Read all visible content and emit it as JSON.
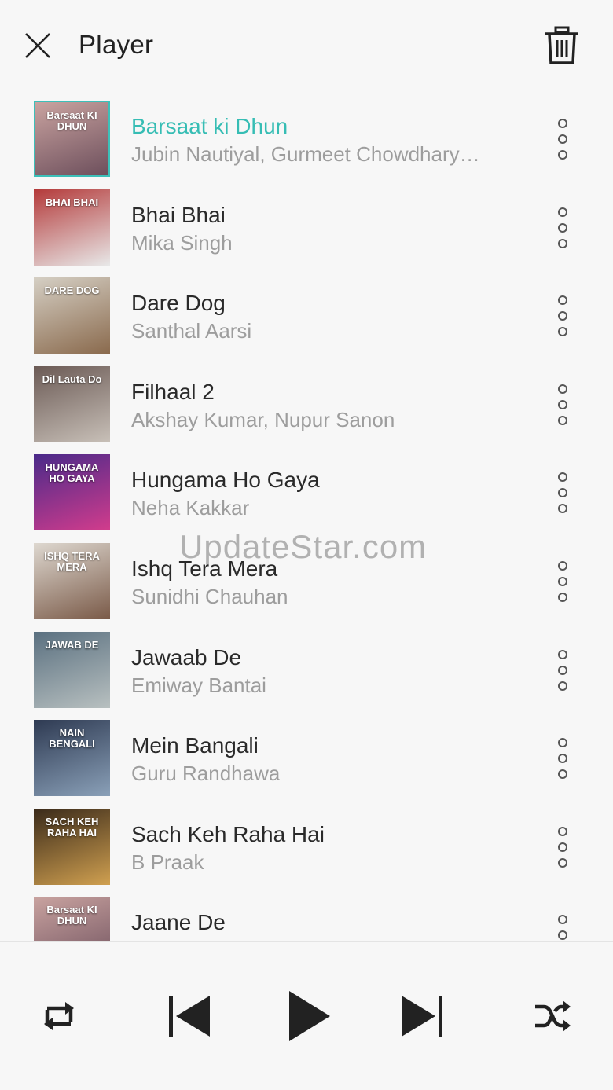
{
  "header": {
    "title": "Player"
  },
  "accent_color": "#36bdb4",
  "watermark": "UpdateStar.com",
  "songs": [
    {
      "title": "Barsaat ki Dhun",
      "artist": "Jubin Nautiyal, Gurmeet Chowdhary…",
      "thumb_text": "Barsaat KI DHUN",
      "active": true
    },
    {
      "title": "Bhai Bhai",
      "artist": "Mika Singh",
      "thumb_text": "BHAI BHAI"
    },
    {
      "title": "Dare Dog",
      "artist": "Santhal Aarsi",
      "thumb_text": "DARE DOG"
    },
    {
      "title": "Filhaal 2",
      "artist": "Akshay Kumar, Nupur Sanon",
      "thumb_text": "Dil Lauta Do"
    },
    {
      "title": "Hungama Ho Gaya",
      "artist": "Neha Kakkar",
      "thumb_text": "HUNGAMA HO GAYA"
    },
    {
      "title": "Ishq Tera Mera",
      "artist": "Sunidhi Chauhan",
      "thumb_text": "ISHQ TERA MERA"
    },
    {
      "title": "Jawaab De",
      "artist": "Emiway Bantai",
      "thumb_text": "JAWAB DE"
    },
    {
      "title": "Mein Bangali",
      "artist": "Guru Randhawa",
      "thumb_text": "NAIN BENGALI"
    },
    {
      "title": "Sach Keh Raha Hai",
      "artist": "B Praak",
      "thumb_text": "SACH KEH RAHA HAI"
    },
    {
      "title": "Jaane De",
      "artist": "",
      "thumb_text": "Barsaat KI DHUN"
    }
  ],
  "icons": {
    "close": "close-icon",
    "trash": "trash-icon",
    "more": "more-vertical-icon",
    "repeat": "repeat-icon",
    "previous": "skip-previous-icon",
    "play": "play-icon",
    "next": "skip-next-icon",
    "shuffle": "shuffle-icon"
  }
}
